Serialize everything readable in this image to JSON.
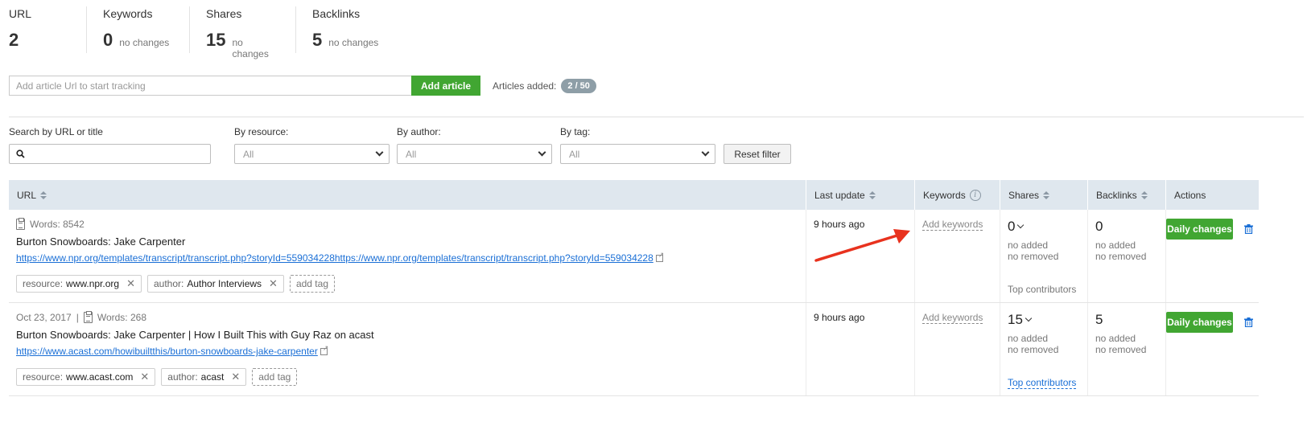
{
  "stats": {
    "url": {
      "label": "URL",
      "value": "2"
    },
    "keywords": {
      "label": "Keywords",
      "value": "0",
      "change": "no changes"
    },
    "shares": {
      "label": "Shares",
      "value": "15",
      "change": "no changes"
    },
    "backlinks": {
      "label": "Backlinks",
      "value": "5",
      "change": "no changes"
    }
  },
  "add_article": {
    "placeholder": "Add article Url to start tracking",
    "button": "Add article",
    "added_label": "Articles added:",
    "added_count": "2 / 50"
  },
  "filters": {
    "search_label": "Search by URL or title",
    "resource_label": "By resource:",
    "resource_value": "All",
    "author_label": "By author:",
    "author_value": "All",
    "tag_label": "By tag:",
    "tag_value": "All",
    "reset": "Reset filter"
  },
  "table": {
    "headers": {
      "url": "URL",
      "last_update": "Last update",
      "keywords": "Keywords",
      "shares": "Shares",
      "backlinks": "Backlinks",
      "actions": "Actions"
    },
    "rows": [
      {
        "date": "",
        "words": "Words: 8542",
        "title": "Burton Snowboards: Jake Carpenter",
        "url": "https://www.npr.org/templates/transcript/transcript.php?storyId=559034228https://www.npr.org/templates/transcript/transcript.php?storyId=559034228",
        "tags": [
          {
            "key": "resource:",
            "value": "www.npr.org"
          },
          {
            "key": "author:",
            "value": "Author Interviews"
          }
        ],
        "add_tag": "add tag",
        "last_update": "9 hours ago",
        "add_keywords": "Add keywords",
        "shares": "0",
        "shares_added": "no added",
        "shares_removed": "no removed",
        "backlinks": "0",
        "backlinks_added": "no added",
        "backlinks_removed": "no removed",
        "top_contributors": "Top contributors",
        "daily_changes": "Daily changes"
      },
      {
        "date": "Oct 23, 2017",
        "words": "Words: 268",
        "title": "Burton Snowboards: Jake Carpenter | How I Built This with Guy Raz on acast",
        "url": "https://www.acast.com/howibuiltthis/burton-snowboards-jake-carpenter",
        "tags": [
          {
            "key": "resource:",
            "value": "www.acast.com"
          },
          {
            "key": "author:",
            "value": "acast"
          }
        ],
        "add_tag": "add tag",
        "last_update": "9 hours ago",
        "add_keywords": "Add keywords",
        "shares": "15",
        "shares_added": "no added",
        "shares_removed": "no removed",
        "backlinks": "5",
        "backlinks_added": "no added",
        "backlinks_removed": "no removed",
        "top_contributors": "Top contributors",
        "daily_changes": "Daily changes"
      }
    ]
  },
  "colors": {
    "accent_green": "#41a632",
    "link_blue": "#1a6fd6",
    "header_bg": "#dfe7ee",
    "annotation_arrow": "#e8321e"
  }
}
